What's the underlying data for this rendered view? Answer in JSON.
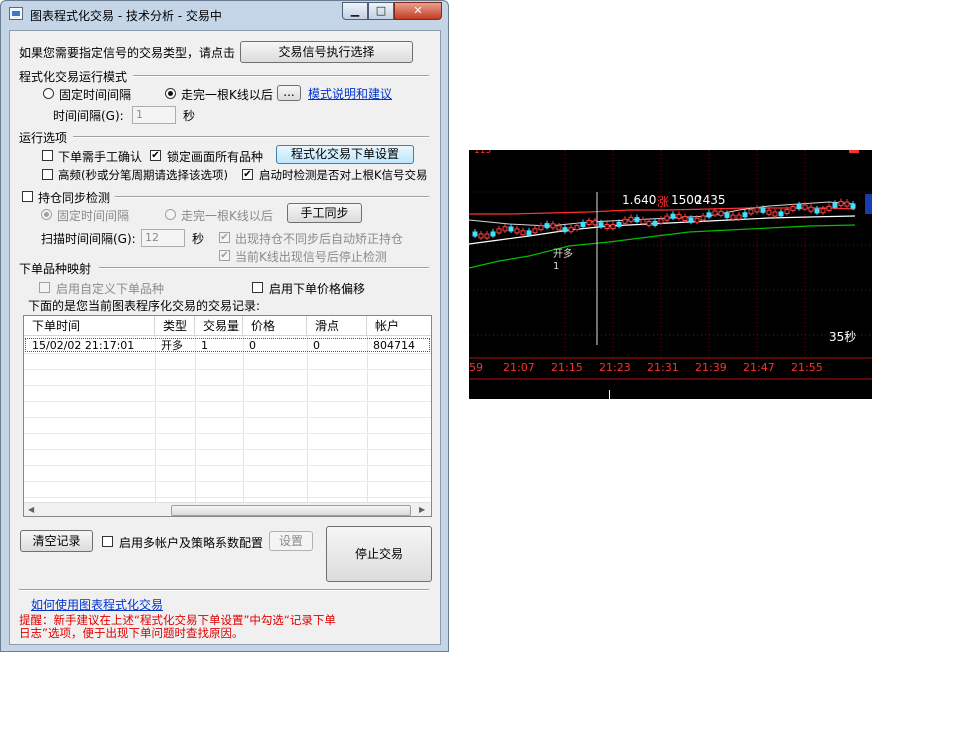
{
  "window": {
    "title": "图表程式化交易 - 技术分析 - 交易中",
    "minimize": "▁",
    "maximize": "□",
    "close": "✕"
  },
  "signal": {
    "prompt": "如果您需要指定信号的交易类型，请点击",
    "button": "交易信号执行选择"
  },
  "mode": {
    "group": "程式化交易运行模式",
    "fixed_interval": "固定时间间隔",
    "after_kline": "走完一根K线以后",
    "after_kline_selected": true,
    "more_button": "...",
    "help_link": "模式说明和建议",
    "interval_label": "时间间隔(G):",
    "interval_value": "1",
    "interval_unit": "秒"
  },
  "run": {
    "group": "运行选项",
    "manual_confirm": "下单需手工确认",
    "manual_confirm_checked": false,
    "lock_all": "锁定画面所有品种",
    "lock_all_checked": true,
    "order_settings_button": "程式化交易下单设置",
    "high_freq": "高频(秒或分笔周期请选择该选项)",
    "high_freq_checked": false,
    "check_on_start": "启动时检测是否对上根K信号交易",
    "check_on_start_checked": true
  },
  "position": {
    "group": "持仓同步检测",
    "group_checked": false,
    "fixed_interval": "固定时间间隔",
    "after_kline": "走完一根K线以后",
    "manual_sync": "手工同步",
    "scan_label": "扫描时间间隔(G):",
    "scan_value": "12",
    "scan_unit": "秒",
    "auto_fix": "出现持仓不同步后自动矫正持仓",
    "auto_fix_checked": true,
    "stop_check": "当前K线出现信号后停止检测",
    "stop_check_checked": true
  },
  "mapping": {
    "group": "下单品种映射",
    "custom": "启用自定义下单品种",
    "custom_checked": false,
    "price_offset": "启用下单价格偏移",
    "price_offset_checked": false
  },
  "records": {
    "caption": "下面的是您当前图表程序化交易的交易记录:",
    "columns": [
      "下单时间",
      "类型",
      "交易量",
      "价格",
      "滑点",
      "帐户"
    ],
    "rows": [
      [
        "15/02/02 21:17:01",
        "开多",
        "1",
        "0",
        "0",
        "804714"
      ]
    ]
  },
  "bottom": {
    "clear_button": "清空记录",
    "multi_account": "启用多帐户及策略系数配置",
    "multi_account_checked": false,
    "settings_button": "设置",
    "stop_button": "停止交易",
    "how_to_link": "如何使用图表程式化交易",
    "tip": "提醒：新手建议在上述“程式化交易下单设置”中勾选“记录下单日志”选项，便于出现下单问题时查找原因。"
  },
  "colors": {
    "tip_red": "#e00000",
    "link_blue": "#0033cc",
    "chart_bg": "#000000",
    "chart_red": "#ff3030"
  },
  "chart": {
    "price_label": "1.640",
    "up_label": "涨",
    "volume_label": "1500",
    "extra_label": "2435",
    "signal_label": "开多",
    "signal_qty": "1",
    "period_label": "35秒",
    "time_ticks": [
      "59",
      "21:07",
      "21:15",
      "21:23",
      "21:31",
      "21:39",
      "21:47",
      "21:55"
    ]
  }
}
